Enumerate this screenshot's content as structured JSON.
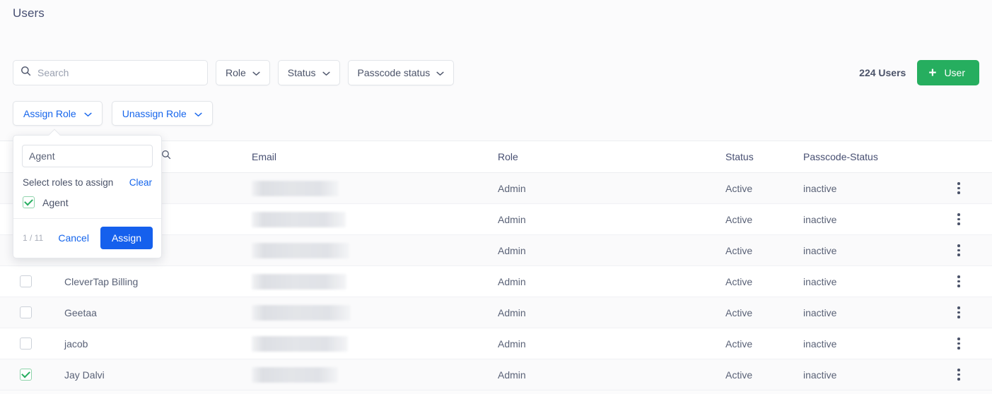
{
  "page": {
    "title": "Users"
  },
  "toolbar": {
    "search_placeholder": "Search",
    "search_value": "",
    "search_icon": "search-icon",
    "filters": [
      {
        "label": "Role"
      },
      {
        "label": "Status"
      },
      {
        "label": "Passcode status"
      }
    ],
    "users_count": "224 Users",
    "add_user_label": "User",
    "add_user_plus": "+",
    "add_user_color": "#26ae5f"
  },
  "role_actions": [
    {
      "label": "Assign Role"
    },
    {
      "label": "Unassign Role"
    }
  ],
  "assign_popover": {
    "search_value": "Agent",
    "search_icon": "search-icon",
    "label": "Select roles to assign",
    "clear_label": "Clear",
    "options": [
      {
        "label": "Agent",
        "checked": true
      }
    ],
    "count": "1 / 11",
    "cancel_label": "Cancel",
    "assign_label": "Assign",
    "assign_color": "#1560ed",
    "link_color": "#1565ec"
  },
  "table": {
    "headers": {
      "name": "",
      "email": "Email",
      "role": "Role",
      "status": "Status",
      "passcode_status": "Passcode-Status"
    },
    "rows": [
      {
        "name": "",
        "email": "",
        "role": "Admin",
        "status": "Active",
        "passcode_status": "inactive",
        "checked": false,
        "email_redacted": true,
        "redact_width": 123
      },
      {
        "name": "",
        "email": "",
        "role": "Admin",
        "status": "Active",
        "passcode_status": "inactive",
        "checked": false,
        "email_redacted": true,
        "redact_width": 133
      },
      {
        "name": "",
        "email": "",
        "role": "Admin",
        "status": "Active",
        "passcode_status": "inactive",
        "checked": false,
        "email_redacted": true,
        "redact_width": 138
      },
      {
        "name": "CleverTap Billing",
        "email": "",
        "role": "Admin",
        "status": "Active",
        "passcode_status": "inactive",
        "checked": false,
        "email_redacted": true,
        "redact_width": 134
      },
      {
        "name": "Geetaa",
        "email": "",
        "role": "Admin",
        "status": "Active",
        "passcode_status": "inactive",
        "checked": false,
        "email_redacted": true,
        "redact_width": 140
      },
      {
        "name": "jacob",
        "email": "",
        "role": "Admin",
        "status": "Active",
        "passcode_status": "inactive",
        "checked": false,
        "email_redacted": true,
        "redact_width": 136
      },
      {
        "name": "Jay Dalvi",
        "email": "",
        "role": "Admin",
        "status": "Active",
        "passcode_status": "inactive",
        "checked": true,
        "email_redacted": true,
        "redact_width": 122
      }
    ]
  }
}
